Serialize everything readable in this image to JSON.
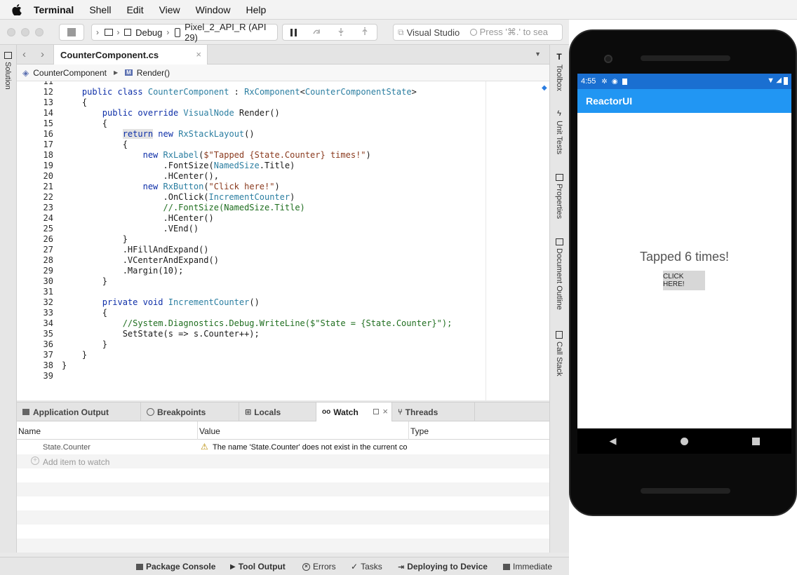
{
  "menubar": {
    "app": "Terminal",
    "items": [
      "Shell",
      "Edit",
      "View",
      "Window",
      "Help"
    ]
  },
  "toolbar": {
    "config": "Debug",
    "device": "Pixel_2_API_R (API 29)",
    "search_scope": "Visual Studio",
    "search_placeholder": "Press '⌘.' to sea"
  },
  "left_pad": {
    "solution": "Solution"
  },
  "right_pad": [
    "Toolbox",
    "Unit Tests",
    "Properties",
    "Document Outline",
    "Call Stack"
  ],
  "editor": {
    "tab_title": "CounterComponent.cs",
    "breadcrumb": {
      "class": "CounterComponent",
      "method": "Render()"
    },
    "lines": [
      {
        "n": "11",
        "t": ""
      },
      {
        "n": "12",
        "t": "    public class CounterComponent : RxComponent<CounterComponentState>"
      },
      {
        "n": "13",
        "t": "    {"
      },
      {
        "n": "14",
        "t": "        public override VisualNode Render()"
      },
      {
        "n": "15",
        "t": "        {"
      },
      {
        "n": "16",
        "t": "            return new RxStackLayout()"
      },
      {
        "n": "17",
        "t": "            {"
      },
      {
        "n": "18",
        "t": "                new RxLabel($\"Tapped {State.Counter} times!\")"
      },
      {
        "n": "19",
        "t": "                    .FontSize(NamedSize.Title)"
      },
      {
        "n": "20",
        "t": "                    .HCenter(),"
      },
      {
        "n": "21",
        "t": "                new RxButton(\"Click here!\")"
      },
      {
        "n": "22",
        "t": "                    .OnClick(IncrementCounter)"
      },
      {
        "n": "23",
        "t": "                    //.FontSize(NamedSize.Title)"
      },
      {
        "n": "24",
        "t": "                    .HCenter()"
      },
      {
        "n": "25",
        "t": "                    .VEnd()"
      },
      {
        "n": "26",
        "t": "            }"
      },
      {
        "n": "27",
        "t": "            .HFillAndExpand()"
      },
      {
        "n": "28",
        "t": "            .VCenterAndExpand()"
      },
      {
        "n": "29",
        "t": "            .Margin(10);"
      },
      {
        "n": "30",
        "t": "        }"
      },
      {
        "n": "31",
        "t": ""
      },
      {
        "n": "32",
        "t": "        private void IncrementCounter()"
      },
      {
        "n": "33",
        "t": "        {"
      },
      {
        "n": "34",
        "t": "            //System.Diagnostics.Debug.WriteLine($\"State = {State.Counter}\");"
      },
      {
        "n": "35",
        "t": "            SetState(s => s.Counter++);"
      },
      {
        "n": "36",
        "t": "        }"
      },
      {
        "n": "37",
        "t": "    }"
      },
      {
        "n": "38",
        "t": "}"
      },
      {
        "n": "39",
        "t": ""
      }
    ]
  },
  "bottom_pad": {
    "tabs": [
      "Application Output",
      "Breakpoints",
      "Locals",
      "Watch",
      "Threads"
    ],
    "active": "Watch",
    "columns": [
      "Name",
      "Value",
      "Type"
    ],
    "rows": [
      {
        "name": "State.Counter",
        "value": "The name 'State.Counter' does not exist in the current co",
        "type": ""
      }
    ],
    "add_item": "Add item to watch"
  },
  "statusbar": [
    "Package Console",
    "Tool Output",
    "Errors",
    "Tasks",
    "Deploying to Device",
    "Immediate"
  ],
  "emulator": {
    "time": "4:55",
    "app_title": "ReactorUI",
    "label": "Tapped 6 times!",
    "button": "CLICK HERE!"
  }
}
